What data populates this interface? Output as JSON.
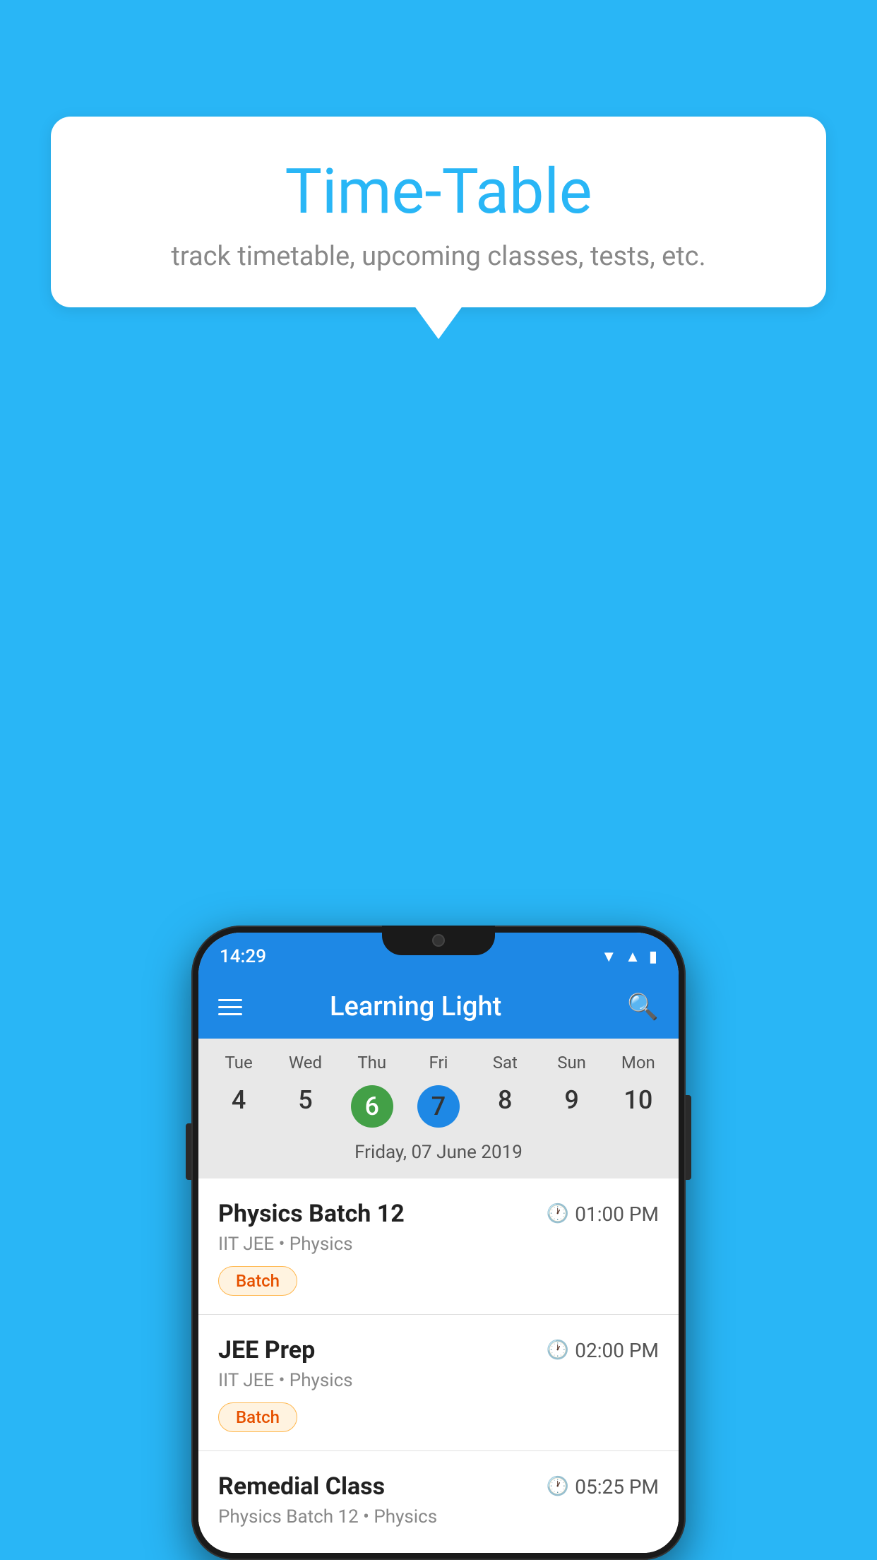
{
  "background_color": "#29b6f6",
  "bubble": {
    "title": "Time-Table",
    "subtitle": "track timetable, upcoming classes, tests, etc."
  },
  "status_bar": {
    "time": "14:29"
  },
  "app_bar": {
    "title": "Learning Light"
  },
  "calendar": {
    "days": [
      {
        "label": "Tue",
        "num": "4"
      },
      {
        "label": "Wed",
        "num": "5"
      },
      {
        "label": "Thu",
        "num": "6",
        "state": "today"
      },
      {
        "label": "Fri",
        "num": "7",
        "state": "selected"
      },
      {
        "label": "Sat",
        "num": "8"
      },
      {
        "label": "Sun",
        "num": "9"
      },
      {
        "label": "Mon",
        "num": "10"
      }
    ],
    "selected_date": "Friday, 07 June 2019"
  },
  "schedule": [
    {
      "title": "Physics Batch 12",
      "time": "01:00 PM",
      "subtitle": "IIT JEE • Physics",
      "badge": "Batch"
    },
    {
      "title": "JEE Prep",
      "time": "02:00 PM",
      "subtitle": "IIT JEE • Physics",
      "badge": "Batch"
    },
    {
      "title": "Remedial Class",
      "time": "05:25 PM",
      "subtitle": "Physics Batch 12 • Physics",
      "badge": null
    }
  ]
}
